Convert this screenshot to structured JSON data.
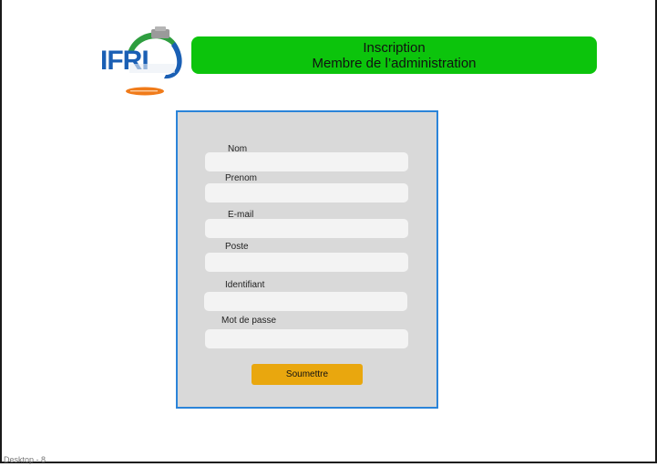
{
  "header": {
    "title_line1": "Inscription",
    "title_line2": "Membre de l’administration"
  },
  "logo": {
    "text": "IFRI",
    "icon": "ifri-logo-icon"
  },
  "form": {
    "fields": [
      {
        "label": "Nom",
        "value": "",
        "placeholder": ""
      },
      {
        "label": "Prenom",
        "value": "",
        "placeholder": ""
      },
      {
        "label": "E-mail",
        "value": "",
        "placeholder": ""
      },
      {
        "label": "Poste",
        "value": "",
        "placeholder": ""
      },
      {
        "label": "Identifiant",
        "value": "",
        "placeholder": ""
      },
      {
        "label": "Mot de passe",
        "value": "",
        "placeholder": ""
      }
    ],
    "submit_label": "Soumettre"
  },
  "footer": {
    "text": "Desktop - 8"
  },
  "colors": {
    "banner": "#0cc40c",
    "panel_background": "#d9d9d9",
    "panel_border": "#2b84d9",
    "input_background": "#f3f3f3",
    "submit_button": "#e9a70e",
    "logo_blue": "#1a5fb4",
    "logo_green": "#2e9e3f",
    "logo_orange": "#f07b1a"
  }
}
